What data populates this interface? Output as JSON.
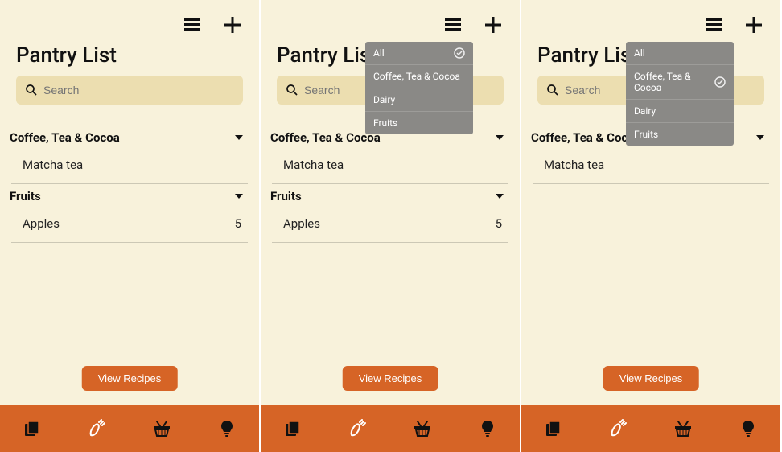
{
  "page_title": "Pantry List",
  "search": {
    "placeholder": "Search"
  },
  "view_recipes_label": "View Recipes",
  "categories": [
    {
      "name": "Coffee, Tea & Cocoa",
      "items": [
        {
          "label": "Matcha tea",
          "qty": ""
        }
      ]
    },
    {
      "name": "Fruits",
      "items": [
        {
          "label": "Apples",
          "qty": "5"
        }
      ]
    }
  ],
  "filter_options": [
    "All",
    "Coffee, Tea & Cocoa",
    "Dairy",
    "Fruits"
  ],
  "screens": [
    {
      "dropdown_open": false,
      "selected_filter": "All",
      "visible_categories": [
        0,
        1
      ]
    },
    {
      "dropdown_open": true,
      "selected_filter": "All",
      "visible_categories": [
        0,
        1
      ]
    },
    {
      "dropdown_open": true,
      "selected_filter": "Coffee, Tea & Cocoa",
      "visible_categories": [
        0
      ]
    }
  ],
  "colors": {
    "accent": "#d66426",
    "background": "#f8f2db",
    "search_bg": "#ecdeb0",
    "dropdown_bg": "#8a8986"
  }
}
